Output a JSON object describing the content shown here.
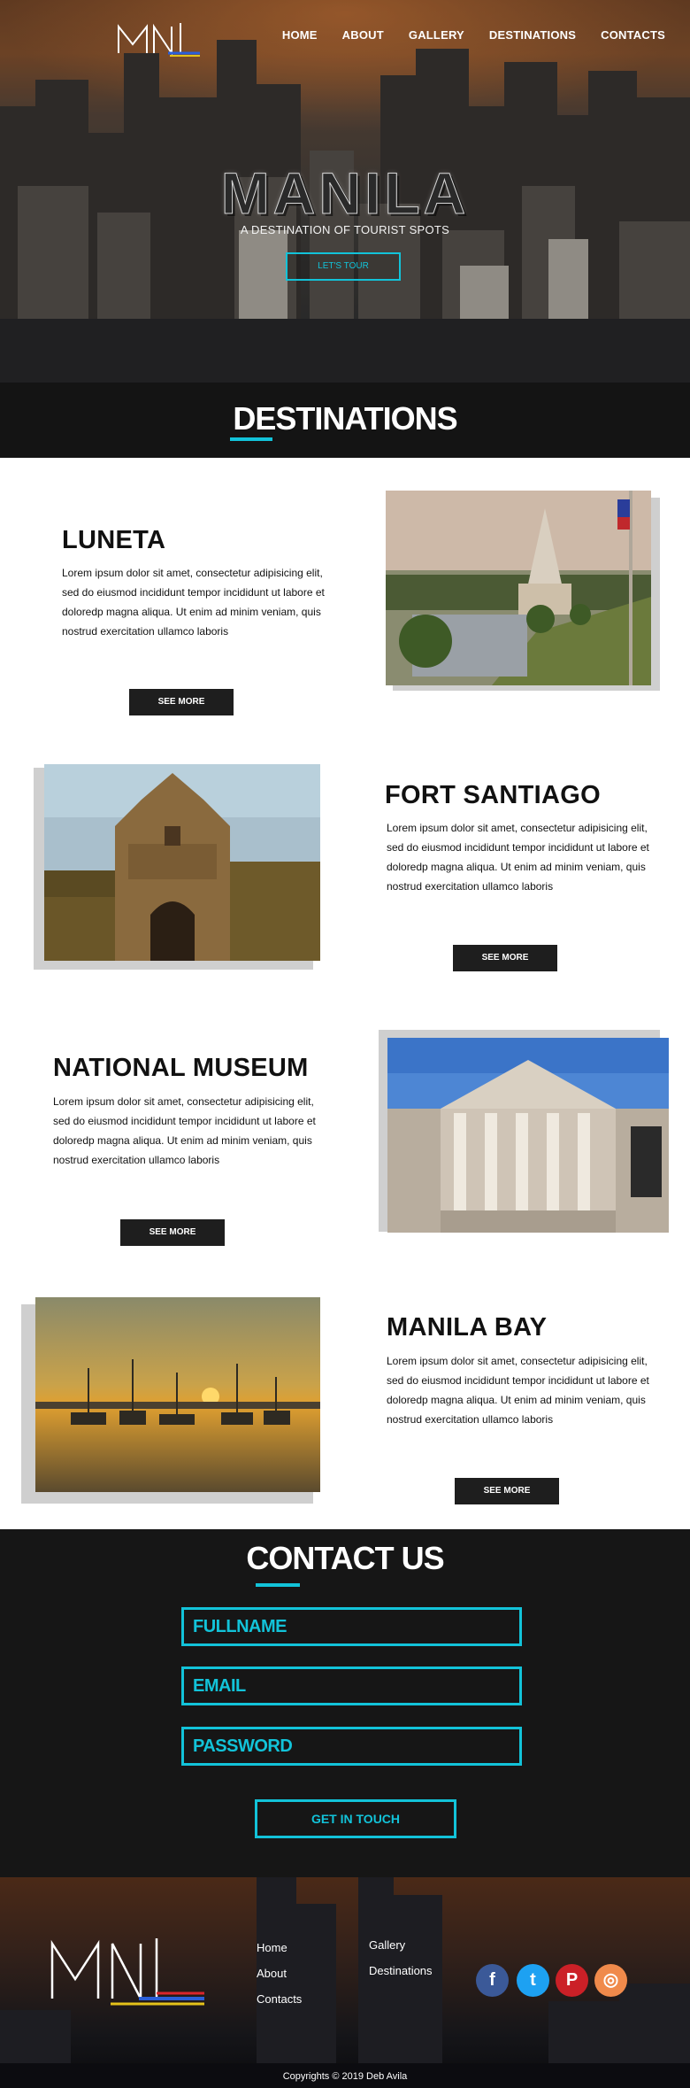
{
  "nav": [
    "HOME",
    "ABOUT",
    "GALLERY",
    "DESTINATIONS",
    "CONTACTS"
  ],
  "hero": {
    "title": "MANILA",
    "subtitle": "A DESTINATION OF TOURIST SPOTS",
    "button": "LET'S TOUR"
  },
  "destinations_heading": "DESTINATIONS",
  "destinations": [
    {
      "title": "LUNETA",
      "text": "Lorem ipsum dolor sit amet, consectetur adipisicing elit, sed do eiusmod incididunt tempor incididunt ut labore et doloredp magna aliqua. Ut enim ad minim veniam, quis nostrud exercitation ullamco laboris",
      "button": "SEE MORE"
    },
    {
      "title": "FORT SANTIAGO",
      "text": "Lorem ipsum dolor sit amet, consectetur adipisicing elit, sed do eiusmod incididunt tempor incididunt ut labore et doloredp magna aliqua. Ut enim ad minim veniam, quis nostrud exercitation ullamco laboris",
      "button": "SEE MORE"
    },
    {
      "title": "NATIONAL MUSEUM",
      "text": "Lorem ipsum dolor sit amet, consectetur adipisicing elit, sed do eiusmod incididunt tempor incididunt ut labore et doloredp magna aliqua. Ut enim ad minim veniam, quis nostrud exercitation ullamco laboris",
      "button": "SEE MORE"
    },
    {
      "title": "MANILA BAY",
      "text": "Lorem ipsum dolor sit amet, consectetur adipisicing elit, sed do eiusmod incididunt tempor incididunt ut labore et doloredp magna aliqua. Ut enim ad minim veniam, quis nostrud exercitation ullamco laboris",
      "button": "SEE MORE"
    }
  ],
  "contact": {
    "heading": "CONTACT US",
    "fields": [
      "FULLNAME",
      "EMAIL",
      "PASSWORD"
    ],
    "button": "GET IN TOUCH"
  },
  "footer": {
    "links_col1": [
      "Home",
      "About",
      "Contacts"
    ],
    "links_col2": [
      "Gallery",
      "Destinations"
    ],
    "social": [
      {
        "name": "facebook-icon",
        "glyph": "f",
        "color": "#3b5998"
      },
      {
        "name": "twitter-icon",
        "glyph": "t",
        "color": "#1da1f2"
      },
      {
        "name": "pinterest-icon",
        "glyph": "P",
        "color": "#cb2027"
      },
      {
        "name": "instagram-icon",
        "glyph": "◎",
        "color": "#f08a4b"
      }
    ],
    "copyright": "Copyrights © 2019 Deb Avila"
  },
  "colors": {
    "accent": "#12c3d9",
    "dark": "#141414"
  }
}
